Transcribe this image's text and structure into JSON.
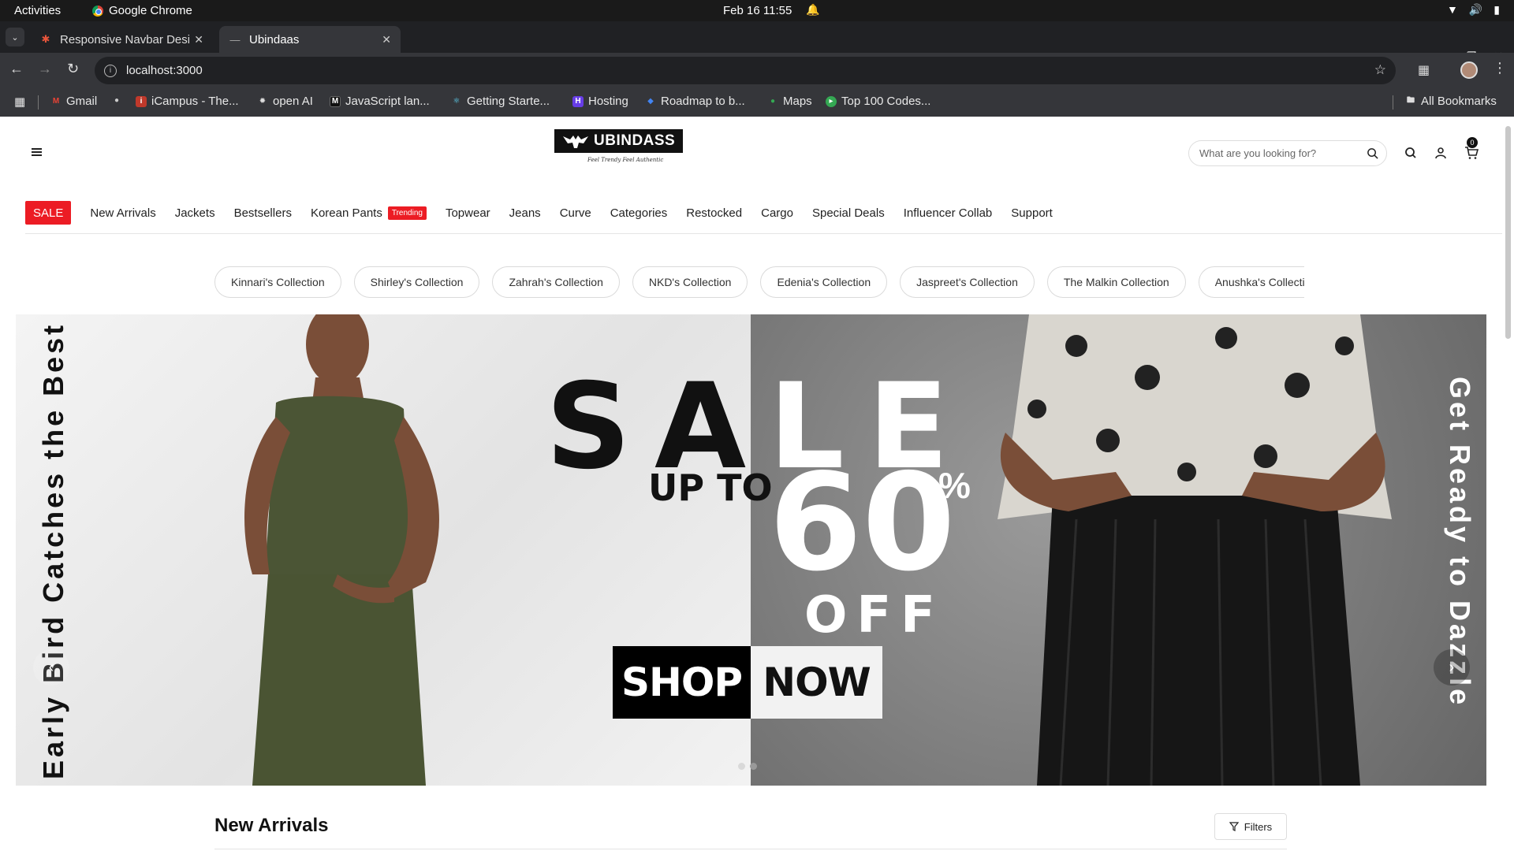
{
  "system": {
    "activities": "Activities",
    "app_name": "Google Chrome",
    "clock": "Feb 16  11:55"
  },
  "browser": {
    "tabs": [
      {
        "title": "Responsive Navbar Desi",
        "active": false
      },
      {
        "title": "Ubindaas",
        "active": true
      }
    ],
    "url": "localhost:3000",
    "bookmarks": [
      {
        "label": "Gmail",
        "icon": "gmail-icon",
        "color": "#ea4335"
      },
      {
        "label": "",
        "icon": "globe-icon",
        "color": "#888888"
      },
      {
        "label": "iCampus - The...",
        "icon": "icampus-icon",
        "color": "#c0392b"
      },
      {
        "label": "open AI",
        "icon": "openai-icon",
        "color": "#222222"
      },
      {
        "label": "JavaScript lan...",
        "icon": "mdn-icon",
        "color": "#111111"
      },
      {
        "label": "Getting Starte...",
        "icon": "react-icon",
        "color": "#61dafb"
      },
      {
        "label": "Hosting",
        "icon": "hostinger-icon",
        "color": "#673de6"
      },
      {
        "label": "Roadmap to b...",
        "icon": "roadmap-icon",
        "color": "#4285f4"
      },
      {
        "label": "Maps",
        "icon": "maps-pin-icon",
        "color": "#34a853"
      },
      {
        "label": "Top 100 Codes...",
        "icon": "codes-icon",
        "color": "#34a853"
      }
    ],
    "all_bookmarks": "All Bookmarks"
  },
  "site": {
    "logo_text": "UBINDASS",
    "tagline": "Feel Trendy Feel Authentic",
    "search_placeholder": "What are you looking for?",
    "cart_count": "0",
    "menu": {
      "sale": "SALE",
      "items": [
        "New Arrivals",
        "Jackets",
        "Bestsellers",
        "Korean Pants",
        "Topwear",
        "Jeans",
        "Curve",
        "Categories",
        "Restocked",
        "Cargo",
        "Special Deals",
        "Influencer Collab",
        "Support"
      ],
      "trending_badge": "Trending"
    },
    "collections": [
      "Kinnari's Collection",
      "Shirley's Collection",
      "Zahrah's Collection",
      "NKD's Collection",
      "Edenia's Collection",
      "Jaspreet's Collection",
      "The Malkin Collection",
      "Anushka's Collection"
    ],
    "banner": {
      "left_vertical": "Early Bird Catches the Best D",
      "right_vertical": "Get Ready to Dazzle",
      "sale_s_a": "SA",
      "sale_l_e": "LE",
      "up_to": "UP TO",
      "discount": "60",
      "percent": "%",
      "off": "OFF",
      "shop": "SHOP",
      "now": "NOW",
      "slides": 2,
      "active_slide": 1
    },
    "section_title": "New Arrivals",
    "filters_label": "Filters",
    "colors": {
      "sale_red": "#ec1c24",
      "black": "#111111"
    }
  }
}
